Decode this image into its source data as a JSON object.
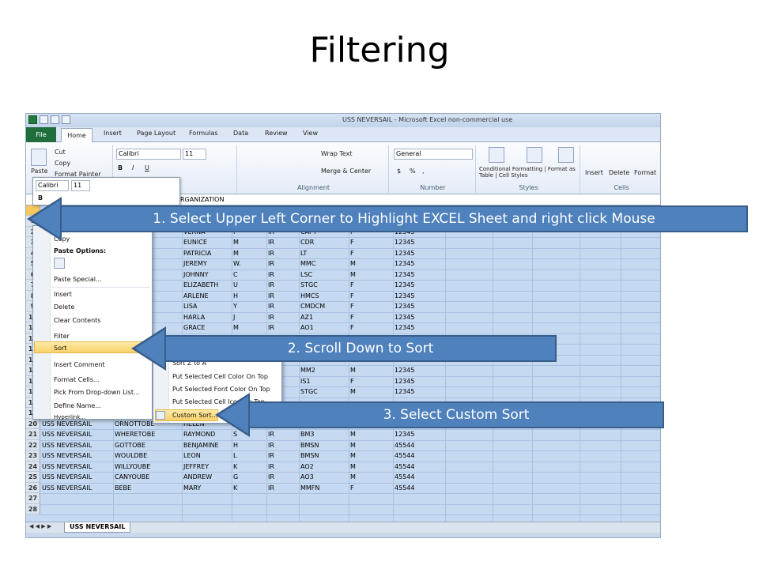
{
  "slide": {
    "title": "Filtering"
  },
  "excel": {
    "window_title": "USS NEVERSAIL  -  Microsoft Excel non-commercial use",
    "tabs": [
      "File",
      "Home",
      "Insert",
      "Page Layout",
      "Formulas",
      "Data",
      "Review",
      "View"
    ],
    "clipboard": {
      "cut": "Cut",
      "copy": "Copy",
      "format_painter": "Format Painter",
      "paste": "Paste"
    },
    "font": {
      "name": "Calibri",
      "size": "11"
    },
    "alignment": {
      "wrap": "Wrap Text",
      "merge": "Merge & Center",
      "label": "Alignment"
    },
    "number": {
      "format": "General",
      "label": "Number",
      "currency": "$",
      "percent": "%",
      "comma": ","
    },
    "styles": {
      "conditional": "Conditional Formatting",
      "format_table": "Format as Table",
      "cell_styles": "Cell Styles",
      "label": "Styles"
    },
    "cells": {
      "insert": "Insert",
      "delete": "Delete",
      "format": "Format",
      "label": "Cells"
    },
    "formula_value": "RGANIZATION",
    "mini_toolbar": {
      "font": "Calibri",
      "size": "11"
    },
    "rows": [
      {
        "n": "1",
        "a": "",
        "b": "",
        "c": "",
        "d": "",
        "e": "",
        "f": "",
        "g": "",
        "h": ""
      },
      {
        "n": "2",
        "a": "",
        "b": "",
        "c": "VERNA",
        "d": "I",
        "e": "IR",
        "f": "CAPT",
        "g": "F",
        "h": "12345"
      },
      {
        "n": "3",
        "a": "",
        "b": "",
        "c": "EUNICE",
        "d": "M",
        "e": "IR",
        "f": "CDR",
        "g": "F",
        "h": "12345"
      },
      {
        "n": "4",
        "a": "",
        "b": "",
        "c": "PATRICIA",
        "d": "M",
        "e": "IR",
        "f": "LT",
        "g": "F",
        "h": "12345"
      },
      {
        "n": "5",
        "a": "",
        "b": "",
        "c": "JEREMY",
        "d": "W.",
        "e": "IR",
        "f": "MMC",
        "g": "M",
        "h": "12345"
      },
      {
        "n": "6",
        "a": "",
        "b": "",
        "c": "JOHNNY",
        "d": "C",
        "e": "IR",
        "f": "LSC",
        "g": "M",
        "h": "12345"
      },
      {
        "n": "7",
        "a": "",
        "b": "",
        "c": "ELIZABETH",
        "d": "U",
        "e": "IR",
        "f": "STGC",
        "g": "F",
        "h": "12345"
      },
      {
        "n": "8",
        "a": "",
        "b": "",
        "c": "ARLENE",
        "d": "H",
        "e": "IR",
        "f": "HMCS",
        "g": "F",
        "h": "12345"
      },
      {
        "n": "9",
        "a": "",
        "b": "",
        "c": "LISA",
        "d": "Y",
        "e": "IR",
        "f": "CMDCM",
        "g": "F",
        "h": "12345"
      },
      {
        "n": "10",
        "a": "",
        "b": "",
        "c": "HARLA",
        "d": "J",
        "e": "IR",
        "f": "AZ1",
        "g": "F",
        "h": "12345"
      },
      {
        "n": "11",
        "a": "",
        "b": "",
        "c": "GRACE",
        "d": "M",
        "e": "IR",
        "f": "AO1",
        "g": "F",
        "h": "12345"
      },
      {
        "n": "12",
        "a": "",
        "b": "",
        "c": "",
        "d": "",
        "e": "",
        "f": "",
        "g": "",
        "h": ""
      },
      {
        "n": "13",
        "a": "",
        "b": "",
        "c": "",
        "d": "",
        "e": "",
        "f": "",
        "g": "",
        "h": ""
      },
      {
        "n": "14",
        "a": "",
        "b": "",
        "c": "",
        "d": "",
        "e": "",
        "f": "HT2",
        "g": "F",
        "h": "12345"
      },
      {
        "n": "15",
        "a": "",
        "b": "",
        "c": "",
        "d": "",
        "e": "",
        "f": "MM2",
        "g": "M",
        "h": "12345"
      },
      {
        "n": "16",
        "a": "",
        "b": "",
        "c": "",
        "d": "",
        "e": "",
        "f": "IS1",
        "g": "F",
        "h": "12345"
      },
      {
        "n": "17",
        "a": "",
        "b": "",
        "c": "",
        "d": "",
        "e": "",
        "f": "STGC",
        "g": "M",
        "h": "12345"
      },
      {
        "n": "18",
        "a": "",
        "b": "",
        "c": "",
        "d": "",
        "e": "",
        "f": "",
        "g": "",
        "h": ""
      },
      {
        "n": "19",
        "a": "",
        "b": "",
        "c": "",
        "d": "",
        "e": "",
        "f": "",
        "g": "",
        "h": ""
      },
      {
        "n": "20",
        "a": "USS NEVERSAIL",
        "b": "ORNOTTOBE",
        "c": "HELEN",
        "d": "E",
        "e": "IR",
        "f": "BM2",
        "g": "F",
        "h": "12345"
      },
      {
        "n": "21",
        "a": "USS NEVERSAIL",
        "b": "WHERETOBE",
        "c": "RAYMOND",
        "d": "S",
        "e": "IR",
        "f": "BM3",
        "g": "M",
        "h": "12345"
      },
      {
        "n": "22",
        "a": "USS NEVERSAIL",
        "b": "GOTTOBE",
        "c": "BENJAMINE",
        "d": "H",
        "e": "IR",
        "f": "BMSN",
        "g": "M",
        "h": "45544"
      },
      {
        "n": "23",
        "a": "USS NEVERSAIL",
        "b": "WOULDBE",
        "c": "LEON",
        "d": "L",
        "e": "IR",
        "f": "BMSN",
        "g": "M",
        "h": "45544"
      },
      {
        "n": "24",
        "a": "USS NEVERSAIL",
        "b": "WILLYOUBE",
        "c": "JEFFREY",
        "d": "K",
        "e": "IR",
        "f": "AO2",
        "g": "M",
        "h": "45544"
      },
      {
        "n": "25",
        "a": "USS NEVERSAIL",
        "b": "CANYOUBE",
        "c": "ANDREW",
        "d": "G",
        "e": "IR",
        "f": "AO3",
        "g": "M",
        "h": "45544"
      },
      {
        "n": "26",
        "a": "USS NEVERSAIL",
        "b": "BEBE",
        "c": "MARY",
        "d": "K",
        "e": "IR",
        "f": "MMFN",
        "g": "F",
        "h": "45544"
      },
      {
        "n": "27",
        "a": "",
        "b": "",
        "c": "",
        "d": "",
        "e": "",
        "f": "",
        "g": "",
        "h": ""
      },
      {
        "n": "28",
        "a": "",
        "b": "",
        "c": "",
        "d": "",
        "e": "",
        "f": "",
        "g": "",
        "h": ""
      }
    ],
    "context_menu": [
      "Copy",
      "Paste Options:",
      "Paste Special...",
      "Insert",
      "Delete",
      "Clear Contents",
      "Filter",
      "Sort",
      "Insert Comment",
      "Format Cells...",
      "Pick From Drop-down List...",
      "Define Name...",
      "Hyperlink..."
    ],
    "sort_submenu": [
      "Sort Z to A",
      "Put Selected Cell Color On Top",
      "Put Selected Font Color On Top",
      "Put Selected Cell Icon On Top",
      "Custom Sort..."
    ],
    "sheet_tab": "USS NEVERSAIL"
  },
  "callouts": {
    "step1": "1. Select Upper Left Corner to Highlight EXCEL Sheet and right click Mouse",
    "step2": "2. Scroll Down to Sort",
    "step3": "3. Select Custom Sort"
  },
  "colors": {
    "accent": "#4f81bd",
    "selection": "#c5d9f1",
    "file_tab": "#1f6e3c"
  }
}
